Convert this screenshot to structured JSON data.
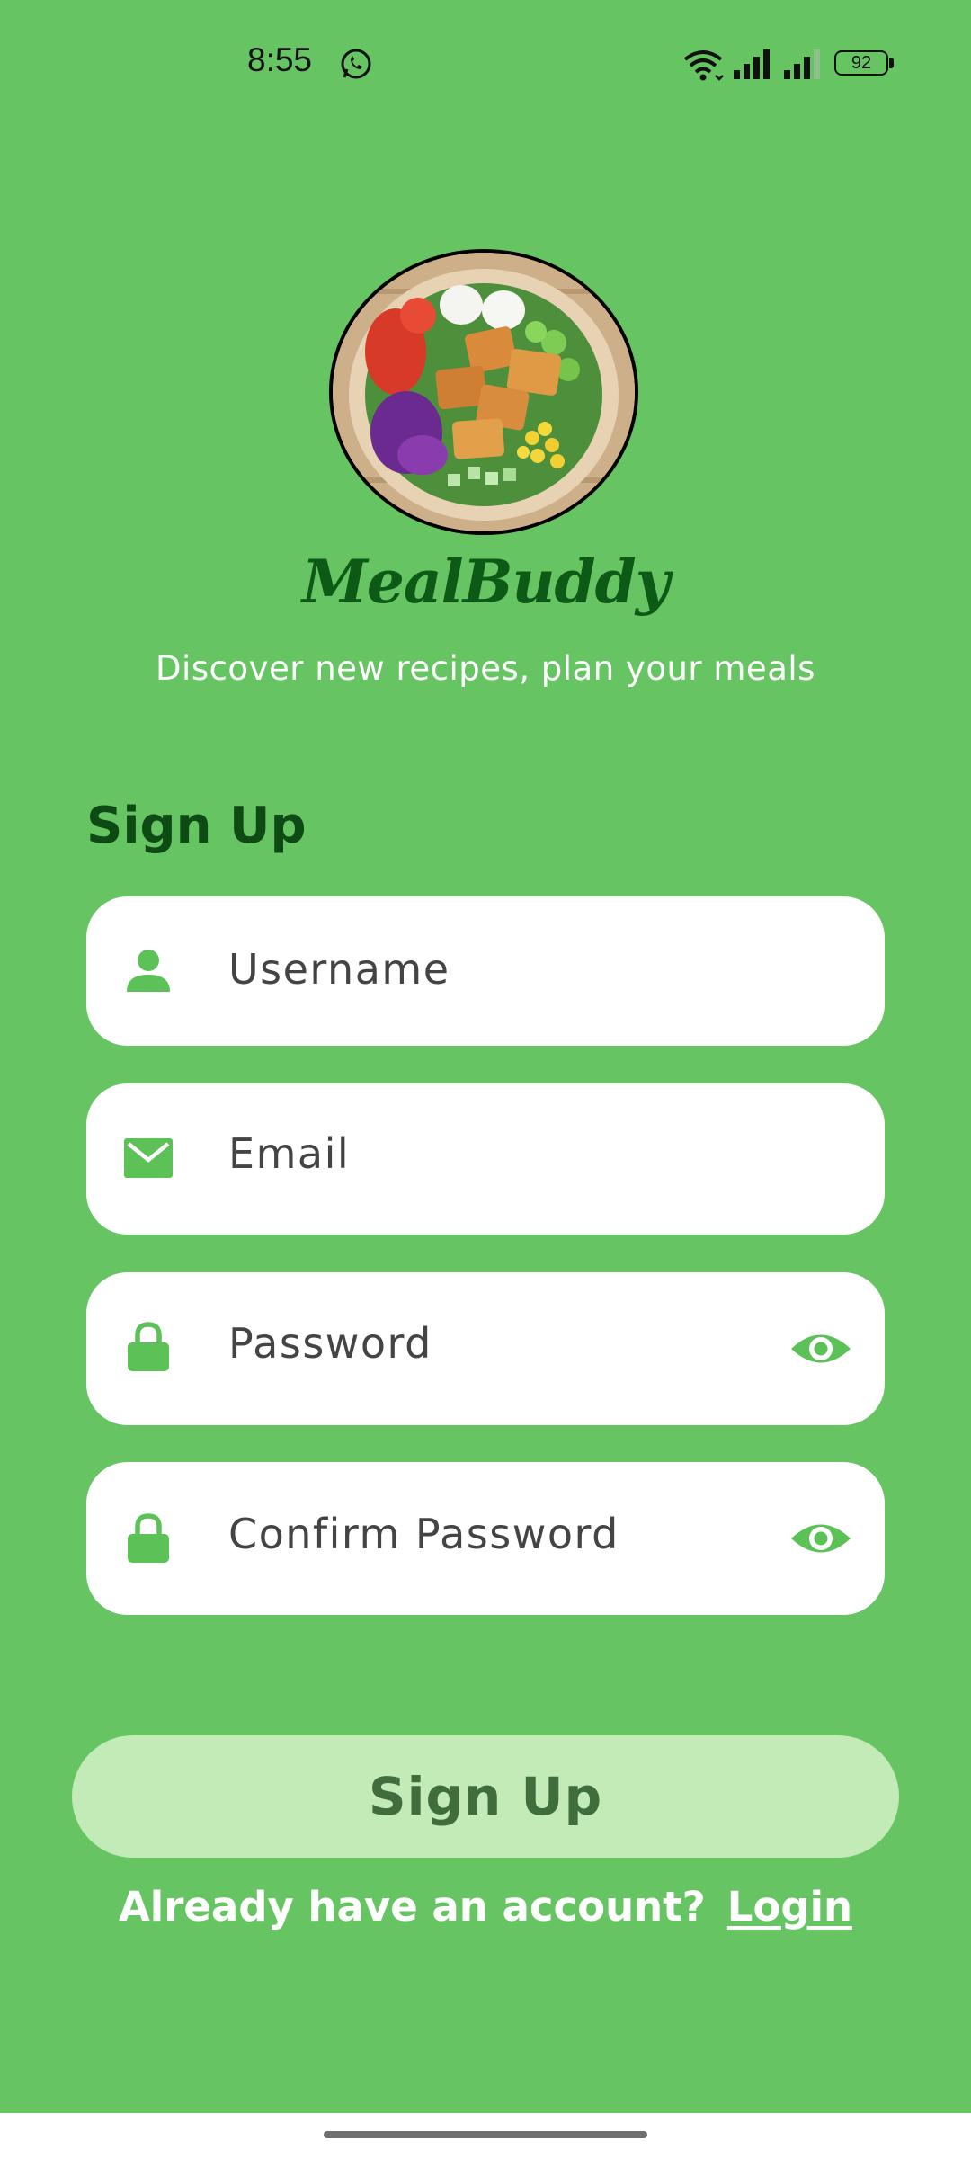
{
  "status_bar": {
    "time": "8:55",
    "battery": "92",
    "icons": [
      "whatsapp-icon",
      "wifi-icon",
      "signal-icon",
      "signal-icon",
      "battery-icon"
    ]
  },
  "app": {
    "name": "MealBuddy",
    "tagline": "Discover new recipes, plan your meals"
  },
  "form": {
    "title": "Sign Up",
    "fields": [
      {
        "label": "Username",
        "icon": "user-icon"
      },
      {
        "label": "Email",
        "icon": "mail-icon"
      },
      {
        "label": "Password",
        "icon": "lock-icon",
        "toggle_icon": "eye-icon"
      },
      {
        "label": "Confirm Password",
        "icon": "lock-icon",
        "toggle_icon": "eye-icon"
      }
    ],
    "submit_label": "Sign Up",
    "login_prompt": "Already have an account?",
    "login_link": "Login"
  },
  "colors": {
    "background": "#66c562",
    "accent": "#5cc258",
    "brand_dark": "#0c5a16",
    "button_bg": "#c2ebb7",
    "button_text": "#3f6e3c"
  }
}
